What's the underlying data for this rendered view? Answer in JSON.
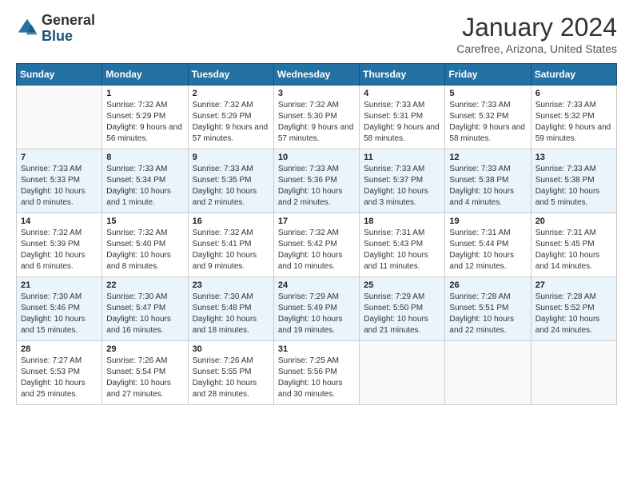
{
  "logo": {
    "general": "General",
    "blue": "Blue"
  },
  "title": "January 2024",
  "subtitle": "Carefree, Arizona, United States",
  "days_of_week": [
    "Sunday",
    "Monday",
    "Tuesday",
    "Wednesday",
    "Thursday",
    "Friday",
    "Saturday"
  ],
  "weeks": [
    [
      {
        "day": "",
        "sunrise": "",
        "sunset": "",
        "daylight": ""
      },
      {
        "day": "1",
        "sunrise": "Sunrise: 7:32 AM",
        "sunset": "Sunset: 5:29 PM",
        "daylight": "Daylight: 9 hours and 56 minutes."
      },
      {
        "day": "2",
        "sunrise": "Sunrise: 7:32 AM",
        "sunset": "Sunset: 5:29 PM",
        "daylight": "Daylight: 9 hours and 57 minutes."
      },
      {
        "day": "3",
        "sunrise": "Sunrise: 7:32 AM",
        "sunset": "Sunset: 5:30 PM",
        "daylight": "Daylight: 9 hours and 57 minutes."
      },
      {
        "day": "4",
        "sunrise": "Sunrise: 7:33 AM",
        "sunset": "Sunset: 5:31 PM",
        "daylight": "Daylight: 9 hours and 58 minutes."
      },
      {
        "day": "5",
        "sunrise": "Sunrise: 7:33 AM",
        "sunset": "Sunset: 5:32 PM",
        "daylight": "Daylight: 9 hours and 58 minutes."
      },
      {
        "day": "6",
        "sunrise": "Sunrise: 7:33 AM",
        "sunset": "Sunset: 5:32 PM",
        "daylight": "Daylight: 9 hours and 59 minutes."
      }
    ],
    [
      {
        "day": "7",
        "sunrise": "Sunrise: 7:33 AM",
        "sunset": "Sunset: 5:33 PM",
        "daylight": "Daylight: 10 hours and 0 minutes."
      },
      {
        "day": "8",
        "sunrise": "Sunrise: 7:33 AM",
        "sunset": "Sunset: 5:34 PM",
        "daylight": "Daylight: 10 hours and 1 minute."
      },
      {
        "day": "9",
        "sunrise": "Sunrise: 7:33 AM",
        "sunset": "Sunset: 5:35 PM",
        "daylight": "Daylight: 10 hours and 2 minutes."
      },
      {
        "day": "10",
        "sunrise": "Sunrise: 7:33 AM",
        "sunset": "Sunset: 5:36 PM",
        "daylight": "Daylight: 10 hours and 2 minutes."
      },
      {
        "day": "11",
        "sunrise": "Sunrise: 7:33 AM",
        "sunset": "Sunset: 5:37 PM",
        "daylight": "Daylight: 10 hours and 3 minutes."
      },
      {
        "day": "12",
        "sunrise": "Sunrise: 7:33 AM",
        "sunset": "Sunset: 5:38 PM",
        "daylight": "Daylight: 10 hours and 4 minutes."
      },
      {
        "day": "13",
        "sunrise": "Sunrise: 7:33 AM",
        "sunset": "Sunset: 5:38 PM",
        "daylight": "Daylight: 10 hours and 5 minutes."
      }
    ],
    [
      {
        "day": "14",
        "sunrise": "Sunrise: 7:32 AM",
        "sunset": "Sunset: 5:39 PM",
        "daylight": "Daylight: 10 hours and 6 minutes."
      },
      {
        "day": "15",
        "sunrise": "Sunrise: 7:32 AM",
        "sunset": "Sunset: 5:40 PM",
        "daylight": "Daylight: 10 hours and 8 minutes."
      },
      {
        "day": "16",
        "sunrise": "Sunrise: 7:32 AM",
        "sunset": "Sunset: 5:41 PM",
        "daylight": "Daylight: 10 hours and 9 minutes."
      },
      {
        "day": "17",
        "sunrise": "Sunrise: 7:32 AM",
        "sunset": "Sunset: 5:42 PM",
        "daylight": "Daylight: 10 hours and 10 minutes."
      },
      {
        "day": "18",
        "sunrise": "Sunrise: 7:31 AM",
        "sunset": "Sunset: 5:43 PM",
        "daylight": "Daylight: 10 hours and 11 minutes."
      },
      {
        "day": "19",
        "sunrise": "Sunrise: 7:31 AM",
        "sunset": "Sunset: 5:44 PM",
        "daylight": "Daylight: 10 hours and 12 minutes."
      },
      {
        "day": "20",
        "sunrise": "Sunrise: 7:31 AM",
        "sunset": "Sunset: 5:45 PM",
        "daylight": "Daylight: 10 hours and 14 minutes."
      }
    ],
    [
      {
        "day": "21",
        "sunrise": "Sunrise: 7:30 AM",
        "sunset": "Sunset: 5:46 PM",
        "daylight": "Daylight: 10 hours and 15 minutes."
      },
      {
        "day": "22",
        "sunrise": "Sunrise: 7:30 AM",
        "sunset": "Sunset: 5:47 PM",
        "daylight": "Daylight: 10 hours and 16 minutes."
      },
      {
        "day": "23",
        "sunrise": "Sunrise: 7:30 AM",
        "sunset": "Sunset: 5:48 PM",
        "daylight": "Daylight: 10 hours and 18 minutes."
      },
      {
        "day": "24",
        "sunrise": "Sunrise: 7:29 AM",
        "sunset": "Sunset: 5:49 PM",
        "daylight": "Daylight: 10 hours and 19 minutes."
      },
      {
        "day": "25",
        "sunrise": "Sunrise: 7:29 AM",
        "sunset": "Sunset: 5:50 PM",
        "daylight": "Daylight: 10 hours and 21 minutes."
      },
      {
        "day": "26",
        "sunrise": "Sunrise: 7:28 AM",
        "sunset": "Sunset: 5:51 PM",
        "daylight": "Daylight: 10 hours and 22 minutes."
      },
      {
        "day": "27",
        "sunrise": "Sunrise: 7:28 AM",
        "sunset": "Sunset: 5:52 PM",
        "daylight": "Daylight: 10 hours and 24 minutes."
      }
    ],
    [
      {
        "day": "28",
        "sunrise": "Sunrise: 7:27 AM",
        "sunset": "Sunset: 5:53 PM",
        "daylight": "Daylight: 10 hours and 25 minutes."
      },
      {
        "day": "29",
        "sunrise": "Sunrise: 7:26 AM",
        "sunset": "Sunset: 5:54 PM",
        "daylight": "Daylight: 10 hours and 27 minutes."
      },
      {
        "day": "30",
        "sunrise": "Sunrise: 7:26 AM",
        "sunset": "Sunset: 5:55 PM",
        "daylight": "Daylight: 10 hours and 28 minutes."
      },
      {
        "day": "31",
        "sunrise": "Sunrise: 7:25 AM",
        "sunset": "Sunset: 5:56 PM",
        "daylight": "Daylight: 10 hours and 30 minutes."
      },
      {
        "day": "",
        "sunrise": "",
        "sunset": "",
        "daylight": ""
      },
      {
        "day": "",
        "sunrise": "",
        "sunset": "",
        "daylight": ""
      },
      {
        "day": "",
        "sunrise": "",
        "sunset": "",
        "daylight": ""
      }
    ]
  ]
}
